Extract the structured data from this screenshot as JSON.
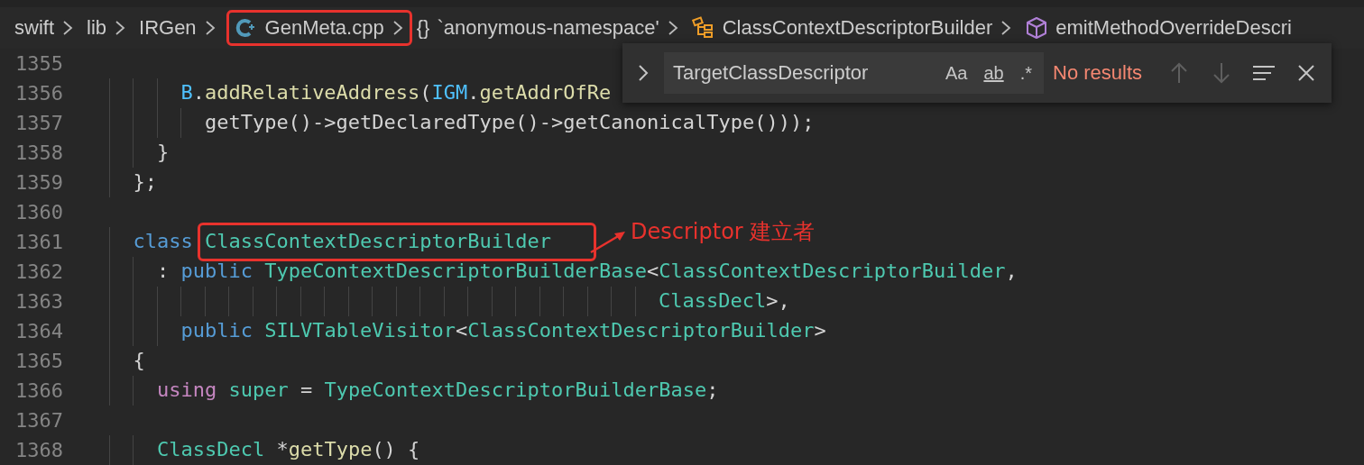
{
  "breadcrumbs": [
    {
      "label": "swift",
      "kind": "folder",
      "highlighted": false
    },
    {
      "label": "lib",
      "kind": "folder",
      "highlighted": false
    },
    {
      "label": "IRGen",
      "kind": "folder",
      "highlighted": false
    },
    {
      "label": "GenMeta.cpp",
      "kind": "file",
      "highlighted": true
    },
    {
      "label": "`anonymous-namespace'",
      "kind": "namespace",
      "glyph": "{}",
      "highlighted": false
    },
    {
      "label": "ClassContextDescriptorBuilder",
      "kind": "class",
      "highlighted": false
    },
    {
      "label": "emitMethodOverrideDescri",
      "kind": "method",
      "highlighted": false
    }
  ],
  "find_widget": {
    "expanded": false,
    "value": "TargetClassDescriptor",
    "options": [
      {
        "label": "Aa",
        "kind": "case",
        "selected": false
      },
      {
        "label": "ab",
        "kind": "word",
        "selected": false
      },
      {
        "label": ".*",
        "kind": "regex",
        "selected": false
      }
    ],
    "status": "No results",
    "previous_disabled": true,
    "next_disabled": true
  },
  "code_lines": [
    {
      "number": "1355"
    },
    {
      "number": "1356",
      "tokens": [
        {
          "text": "      B",
          "kind": "variable"
        },
        {
          "text": ".",
          "kind": "plain"
        },
        {
          "text": "addRelativeAddress",
          "kind": "function"
        },
        {
          "text": "(",
          "kind": "plain"
        },
        {
          "text": "IGM",
          "kind": "variable"
        },
        {
          "text": ".",
          "kind": "plain"
        },
        {
          "text": "getAddrOfRe",
          "kind": "function"
        }
      ]
    },
    {
      "number": "1357",
      "tokens": [
        {
          "text": "        getType()->getDeclaredType()->getCanonicalType()));",
          "kind": "plain"
        }
      ]
    },
    {
      "number": "1358",
      "tokens": [
        {
          "text": "    }",
          "kind": "plain"
        }
      ]
    },
    {
      "number": "1359",
      "tokens": [
        {
          "text": "  };",
          "kind": "plain"
        }
      ]
    },
    {
      "number": "1360"
    },
    {
      "number": "1361",
      "tokens": [
        {
          "text": "  class",
          "kind": "keyword",
          "highlighted": false
        },
        {
          "text": "ClassContextDescriptorBuilder",
          "kind": "type",
          "highlighted": true
        }
      ],
      "annotation": "Descriptor 建立者"
    },
    {
      "number": "1362",
      "tokens": [
        {
          "text": "    :",
          "kind": "plain"
        },
        {
          "text": "public",
          "kind": "keyword"
        },
        {
          "text": "TypeContextDescriptorBuilderBase",
          "kind": "type"
        },
        {
          "text": "<",
          "kind": "plain"
        },
        {
          "text": "ClassContextDescriptorBuilder",
          "kind": "type"
        },
        {
          "text": ",",
          "kind": "plain"
        }
      ]
    },
    {
      "number": "1363",
      "tokens": [
        {
          "text": "                                              ClassDecl",
          "kind": "type"
        },
        {
          "text": ">,",
          "kind": "plain"
        }
      ]
    },
    {
      "number": "1364",
      "tokens": [
        {
          "text": "      public",
          "kind": "keyword"
        },
        {
          "text": "SILVTableVisitor",
          "kind": "type"
        },
        {
          "text": "<",
          "kind": "plain"
        },
        {
          "text": "ClassContextDescriptorBuilder",
          "kind": "type"
        },
        {
          "text": ">",
          "kind": "plain"
        }
      ]
    },
    {
      "number": "1365",
      "tokens": [
        {
          "text": "  {",
          "kind": "plain"
        }
      ]
    },
    {
      "number": "1366",
      "tokens": [
        {
          "text": "    using",
          "kind": "storage"
        },
        {
          "text": "super",
          "kind": "type"
        },
        {
          "text": "=",
          "kind": "plain"
        },
        {
          "text": "TypeContextDescriptorBuilderBase",
          "kind": "type"
        },
        {
          "text": ";",
          "kind": "plain"
        }
      ]
    },
    {
      "number": "1367"
    },
    {
      "number": "1368",
      "tokens": [
        {
          "text": "    ClassDecl",
          "kind": "type"
        },
        {
          "text": "*",
          "kind": "plain"
        },
        {
          "text": "getType",
          "kind": "function"
        },
        {
          "text": "() {",
          "kind": "plain"
        }
      ]
    }
  ]
}
